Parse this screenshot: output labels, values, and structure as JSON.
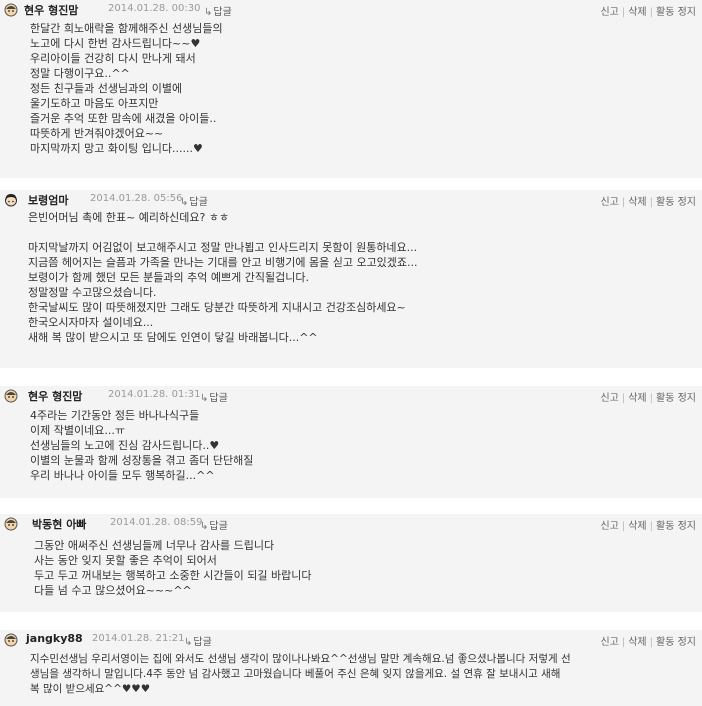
{
  "comments": [
    {
      "nickname": "현우 형진맘",
      "date": "2014.01.28. 00:30",
      "reply": "답글",
      "actions": [
        "신고",
        "삭제",
        "활동 정지"
      ],
      "avatar": "face-avatar",
      "body": "한달간 희노애락을 함께해주신 선생님들의\n노고에 다시 한번 감사드립니다~~♥\n우리아이들 건강히 다시 만나게 돼서\n정말 다행이구요..^^\n정든 친구들과 선생님과의 이별에\n울기도하고 마음도 아프지만\n즐거운 추억 또한 맘속에 새겼을 아이들..\n따뜻하게 반겨줘야겠어요~~\n마지막까지 망고 화이팅 입니다......♥"
    },
    {
      "nickname": "보령엄마",
      "date": "2014.01.28. 05:56",
      "reply": "답글",
      "actions": [
        "신고",
        "삭제",
        "활동 정지"
      ],
      "avatar": "girl-avatar",
      "body": "은빈어머님 촉에 한표~ 예리하신데요? ㅎㅎ\n\n마지막날까지 어김없이 보고해주시고 정말 만나뵙고 인사드리지 못함이 원통하네요...\n지금쯤 헤어지는 슬픔과 가족을 만나는 기대를 안고 비행기에 몸을 싣고 오고있겠죠...\n보령이가 함께 했던 모든 분들과의 추억 예쁘게 간직될겁니다.\n정말정말 수고많으셨습니다.\n한국날씨도 많이 따뜻해졌지만 그래도 당분간 따뜻하게 지내시고 건강조심하세요~\n한국오시자마자 설이네요...\n새해 복 많이 받으시고 또 담에도 인연이 닿길 바래봅니다...^^"
    },
    {
      "nickname": "현우 형진맘",
      "date": "2014.01.28. 01:31",
      "reply": "답글",
      "actions": [
        "신고",
        "삭제",
        "활동 정지"
      ],
      "avatar": "face-avatar",
      "body": "4주라는 기간동안 정든 바나나식구들\n이제 작별이네요...ㅠ\n선생님들의 노고에 진심 감사드립니다..♥\n이별의 눈물과 함께 성장통을 겪고 좀더 단단해질\n우리 바나나 아이들 모두 행복하길...^^"
    },
    {
      "nickname": "박동현 아빠",
      "date": "2014.01.28. 08:59",
      "reply": "답글",
      "actions": [
        "신고",
        "삭제",
        "활동 정지"
      ],
      "avatar": "face-avatar",
      "body": "그동안 애써주신 선생님들께 너무나 감사를 드립니다\n사는 동안 잊지 못할 좋은 추억이 되어서\n두고 두고 꺼내보는 행복하고 소중한 시간들이 되길 바랍니다\n다들 넘 수고 많으셨어요~~~^^"
    },
    {
      "nickname": "jangky88",
      "date": "2014.01.28. 21:21",
      "reply": "답글",
      "actions": [
        "신고",
        "삭제",
        "활동 정지"
      ],
      "avatar": "face-avatar",
      "body": "지수민선생님 우리서영이는 집에 와서도 선생님 생각이 많이나나봐요^^선생님 말만 계속해요.넘 좋으셨나봅니다 저렇게 선\n생님을 생각하니 말입니다.4주 동안 넘 감사했고 고마웠습니다 베풀어 주신 은혜 잊지 않을게요. 설 연휴 잘 보내시고 새해\n복 많이 받으세요^^♥♥♥"
    }
  ]
}
